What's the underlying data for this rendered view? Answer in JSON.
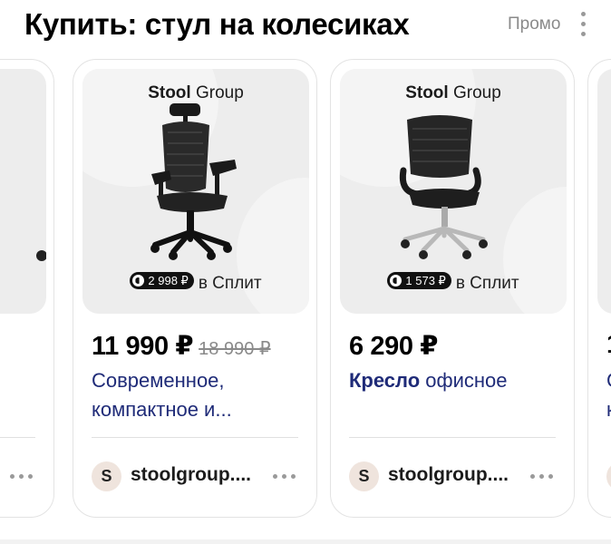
{
  "header": {
    "title": "Купить: стул на колесиках",
    "promo_label": "Промо"
  },
  "cards": [
    {
      "brand_bold": "Stool",
      "brand_rest": "Group",
      "split_amount": "2 998 ₽",
      "split_label": "в Сплит",
      "price": "11 990 ₽",
      "old_price": "18 990 ₽",
      "title_line1": "Современное,",
      "title_line2": "компактное и...",
      "seller_initial": "S",
      "seller_name": "stoolgroup...."
    },
    {
      "brand_bold": "Stool",
      "brand_rest": "Group",
      "split_amount": "1 573 ₽",
      "split_label": "в Сплит",
      "price": "6 290 ₽",
      "title_bold": "Кресло",
      "title_rest": " офисное",
      "seller_initial": "S",
      "seller_name": "stoolgroup...."
    }
  ],
  "edge_card": {
    "price_fragment": "1",
    "title_fragment_line1": "С",
    "title_fragment_line2": "к"
  },
  "colors": {
    "title_link": "#1f2b78",
    "muted": "#8a8a8a",
    "image_bg": "#ededed"
  }
}
